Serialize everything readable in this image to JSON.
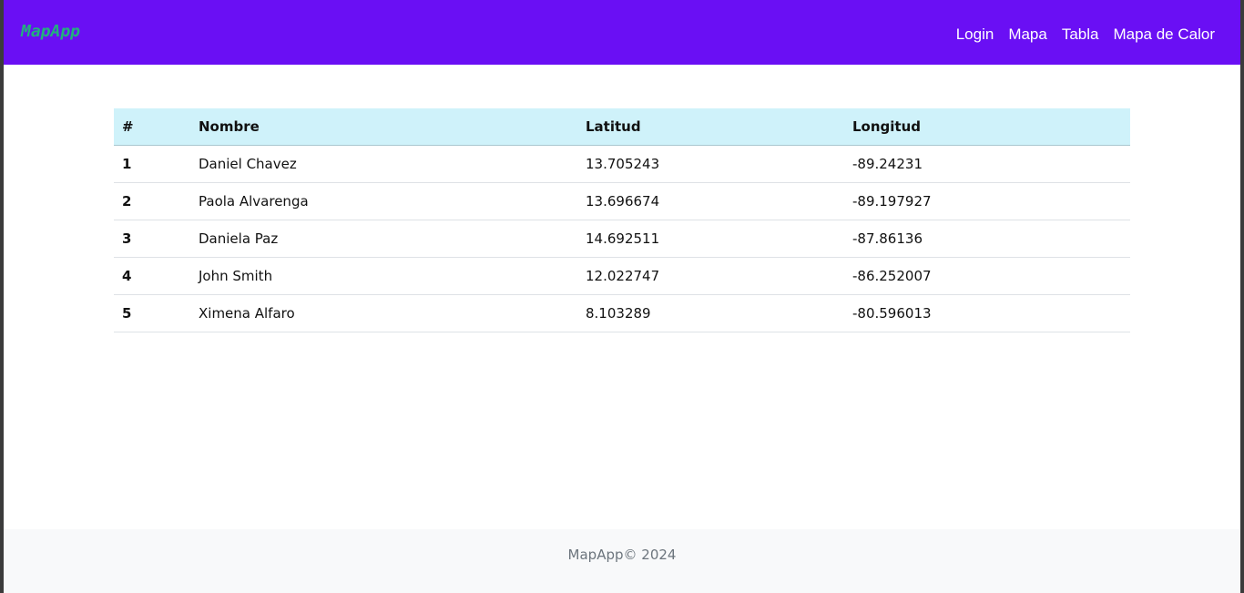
{
  "navbar": {
    "brand": "MapApp",
    "links": [
      "Login",
      "Mapa",
      "Tabla",
      "Mapa de Calor"
    ],
    "bg_color": "#6a0ff4",
    "brand_color": "#22b07d"
  },
  "table": {
    "headers": [
      "#",
      "Nombre",
      "Latitud",
      "Longitud"
    ],
    "rows": [
      [
        "1",
        "Daniel Chavez",
        "13.705243",
        "-89.24231"
      ],
      [
        "2",
        "Paola Alvarenga",
        "13.696674",
        "-89.197927"
      ],
      [
        "3",
        "Daniela Paz",
        "14.692511",
        "-87.86136"
      ],
      [
        "4",
        "John Smith",
        "12.022747",
        "-86.252007"
      ],
      [
        "5",
        "Ximena Alfaro",
        "8.103289",
        "-80.596013"
      ]
    ],
    "header_bg": "#cff2fa"
  },
  "footer": {
    "text": "MapApp© 2024"
  }
}
